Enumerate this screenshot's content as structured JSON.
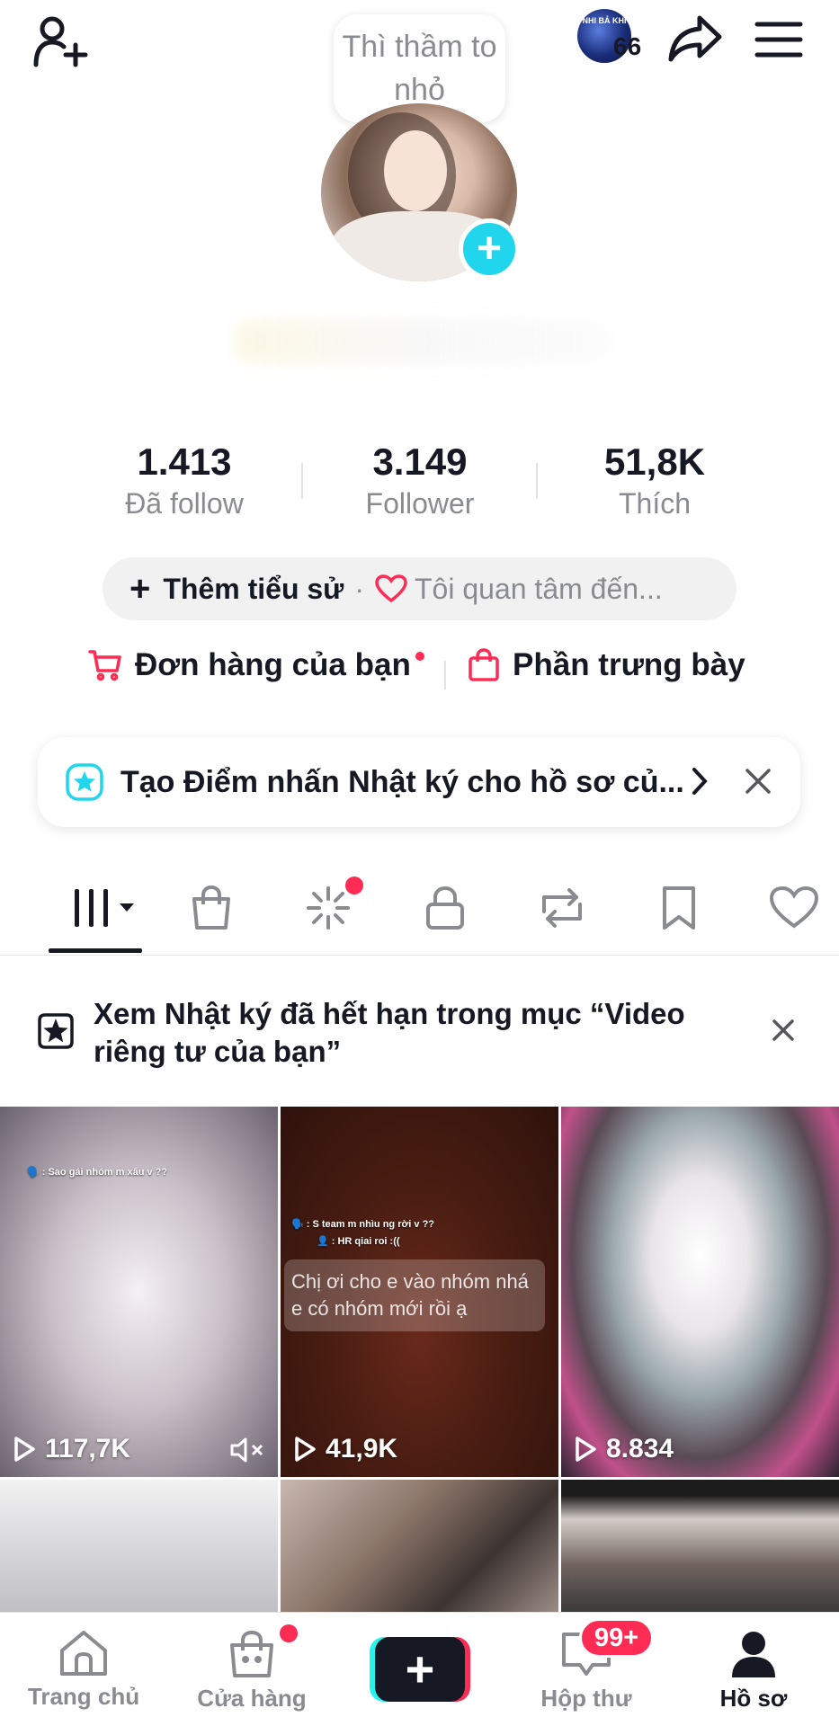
{
  "header": {
    "tooltip_text": "Thì thầm to nhỏ",
    "badge_label": "NHI BẢ KHI",
    "badge_count": "66"
  },
  "stats": [
    {
      "value": "1.413",
      "label": "Đã follow"
    },
    {
      "value": "3.149",
      "label": "Follower"
    },
    {
      "value": "51,8K",
      "label": "Thích"
    }
  ],
  "bio": {
    "add_label": "Thêm tiểu sử",
    "separator": "·",
    "interest_label": "Tôi quan tâm đến..."
  },
  "shop": {
    "orders_label": "Đơn hàng của bạn",
    "showcase_label": "Phần trưng bày"
  },
  "highlight_banner": {
    "text": "Tạo Điểm nhấn Nhật ký cho hồ sơ củ..."
  },
  "notice": {
    "text": "Xem Nhật ký đã hết hạn trong mục “Video riêng tư của bạn”"
  },
  "videos": [
    {
      "views": "117,7K",
      "caption": "🗣️ : Sao gái nhóm m xấu v ??",
      "muted": true
    },
    {
      "views": "41,9K",
      "caption": "🗣️ : S team m nhìu ng rời v ??",
      "caption2": "👤 : HR qiai roi :((",
      "overlay": "Chị ơi cho e vào nhóm nhá e có nhóm mới rồi ạ"
    },
    {
      "views": "8.834"
    }
  ],
  "bottom_nav": {
    "home": "Trang chủ",
    "shop": "Cửa hàng",
    "inbox": "Hộp thư",
    "inbox_badge": "99+",
    "profile": "Hồ sơ"
  },
  "colors": {
    "accent_red": "#fe2c55",
    "accent_cyan": "#20d5ec",
    "text_primary": "#161823",
    "text_secondary": "#8a8b91"
  }
}
